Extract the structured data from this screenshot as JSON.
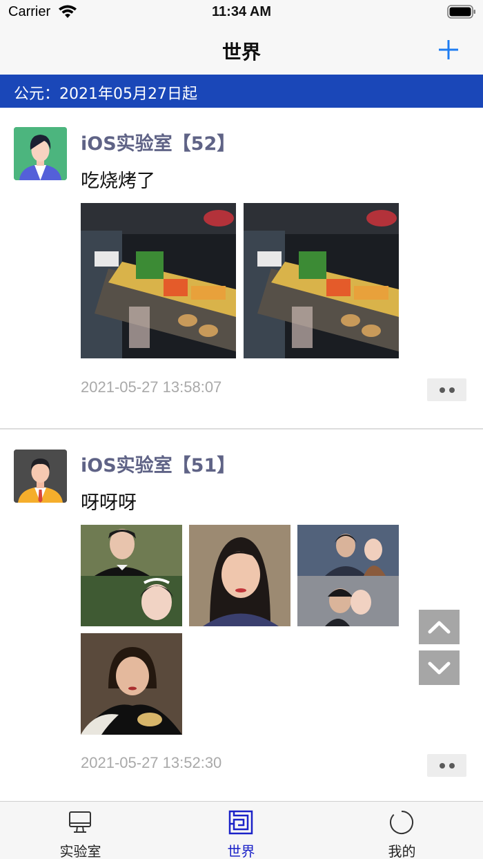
{
  "status_bar": {
    "carrier": "Carrier",
    "time": "11:34 AM",
    "icons": [
      "wifi-icon",
      "battery-icon"
    ]
  },
  "nav": {
    "title": "世界",
    "add_icon": "plus-icon",
    "accent_color": "#1e7cf2"
  },
  "era_banner": {
    "text": "公元：2021年05月27日起",
    "color": "#1a47b8"
  },
  "posts": [
    {
      "author": "iOS实验室【52】",
      "text": "吃烧烤了",
      "time": "2021-05-27 13:58:07",
      "photos": [
        "night-bbq-stall-photo",
        "night-bbq-stall-photo"
      ],
      "avatar": "avatar-woman-green"
    },
    {
      "author": "iOS实验室【51】",
      "text": "呀呀呀",
      "time": "2021-05-27 13:52:30",
      "photos": [
        "wedding-couple-photo",
        "woman-portrait-photo",
        "couple-kiss-photo",
        "woman-fur-coat-photo"
      ],
      "avatar": "avatar-man-orange"
    }
  ],
  "scroll_controls": {
    "up_icon": "chevron-up-icon",
    "down_icon": "chevron-down-icon"
  },
  "tab_bar": {
    "tabs": [
      {
        "label": "实验室",
        "icon": "monitor-icon",
        "active": false
      },
      {
        "label": "世界",
        "icon": "maze-icon",
        "active": true
      },
      {
        "label": "我的",
        "icon": "circle-icon",
        "active": false
      }
    ],
    "active_color": "#1b22c8"
  }
}
